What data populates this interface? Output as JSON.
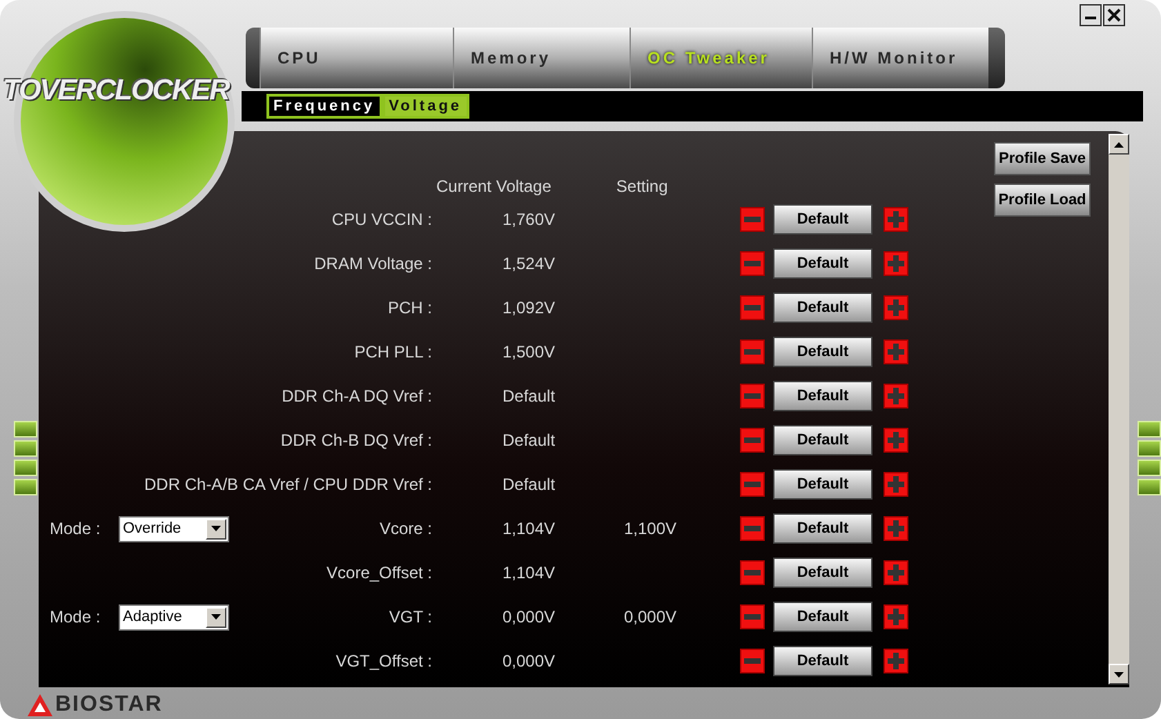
{
  "logo": {
    "text": "TOVERCLOCKER"
  },
  "tabs": [
    {
      "label": "CPU",
      "selected": false
    },
    {
      "label": "Memory",
      "selected": false
    },
    {
      "label": "OC Tweaker",
      "selected": true
    },
    {
      "label": "H/W Monitor",
      "selected": false
    }
  ],
  "subtabs": [
    {
      "label": "Frequency",
      "selected": false
    },
    {
      "label": "Voltage",
      "selected": true
    }
  ],
  "columns": [
    "Current Voltage",
    "Setting"
  ],
  "profile_buttons": [
    "Profile Save",
    "Profile Load"
  ],
  "rows": [
    {
      "label": "CPU VCCIN :",
      "current": "1,760V",
      "button": "Default"
    },
    {
      "label": "DRAM Voltage :",
      "current": "1,524V",
      "button": "Default"
    },
    {
      "label": "PCH :",
      "current": "1,092V",
      "button": "Default"
    },
    {
      "label": "PCH PLL :",
      "current": "1,500V",
      "button": "Default"
    },
    {
      "label": "DDR Ch-A DQ Vref :",
      "current": "Default",
      "button": "Default"
    },
    {
      "label": "DDR Ch-B DQ Vref :",
      "current": "Default",
      "button": "Default"
    },
    {
      "label": "DDR Ch-A/B CA Vref / CPU DDR Vref :",
      "current": "Default",
      "button": "Default"
    },
    {
      "label": "Vcore :",
      "current": "1,104V",
      "setting": "1,100V",
      "mode": {
        "label": "Mode :",
        "value": "Override"
      },
      "button": "Default"
    },
    {
      "label": "Vcore_Offset :",
      "current": "1,104V",
      "button": "Default"
    },
    {
      "label": "VGT :",
      "current": "0,000V",
      "setting": "0,000V",
      "mode": {
        "label": "Mode :",
        "value": "Adaptive"
      },
      "button": "Default"
    },
    {
      "label": "VGT_Offset :",
      "current": "0,000V",
      "button": "Default"
    }
  ],
  "brand": {
    "text": "BIOSTAR"
  }
}
